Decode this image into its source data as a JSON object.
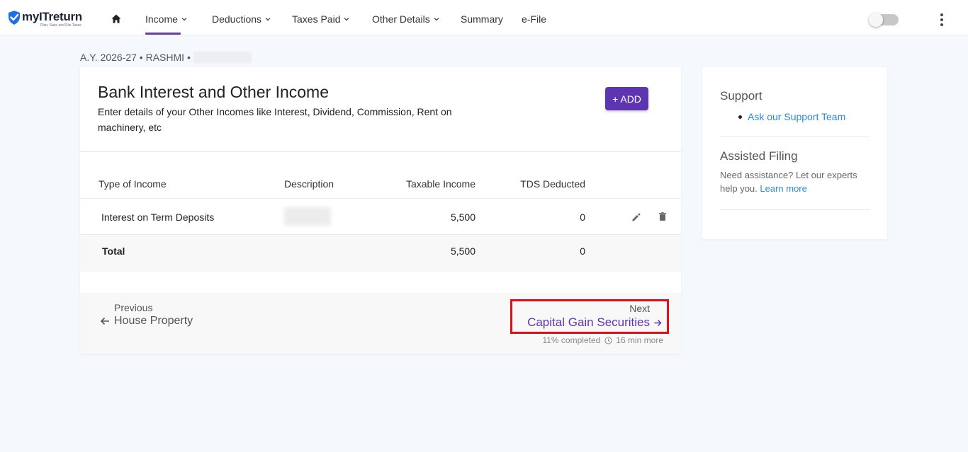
{
  "brand": {
    "name": "myITreturn",
    "tagline": "Plan, Save and File Taxes",
    "color": "#1e6fe0"
  },
  "nav": {
    "home_icon": "home-icon",
    "items": [
      {
        "label": "Income",
        "active": true,
        "has_dropdown": true
      },
      {
        "label": "Deductions",
        "has_dropdown": true
      },
      {
        "label": "Taxes Paid",
        "has_dropdown": true
      },
      {
        "label": "Other Details",
        "has_dropdown": true
      },
      {
        "label": "Summary",
        "has_dropdown": false
      },
      {
        "label": "e-File",
        "has_dropdown": false
      }
    ],
    "accent": "#6a3ab2",
    "toggle_on": false
  },
  "breadcrumb": {
    "text": "A.Y. 2026-27 • RASHMI •"
  },
  "main": {
    "title": "Bank Interest and Other Income",
    "subtitle": "Enter details of your Other Incomes like Interest, Dividend, Commission, Rent on machinery, etc",
    "add_label": "+ ADD",
    "table": {
      "headers": [
        "Type of Income",
        "Description",
        "Taxable Income",
        "TDS Deducted"
      ],
      "rows": [
        {
          "type": "Interest on Term Deposits",
          "description": "",
          "taxable": "5,500",
          "tds": "0"
        }
      ],
      "total": {
        "label": "Total",
        "taxable": "5,500",
        "tds": "0"
      }
    },
    "footer": {
      "prev_label": "Previous",
      "prev_link": "House Property",
      "next_label": "Next",
      "next_link": "Capital Gain Securities",
      "progress_text": "11% completed",
      "time_text": "16 min more",
      "highlight_color": "#e0101a"
    }
  },
  "sidebar": {
    "support_title": "Support",
    "support_link": "Ask our Support Team",
    "assisted_title": "Assisted Filing",
    "assisted_text": "Need assistance? Let our experts help you.",
    "assisted_link": "Learn more"
  }
}
